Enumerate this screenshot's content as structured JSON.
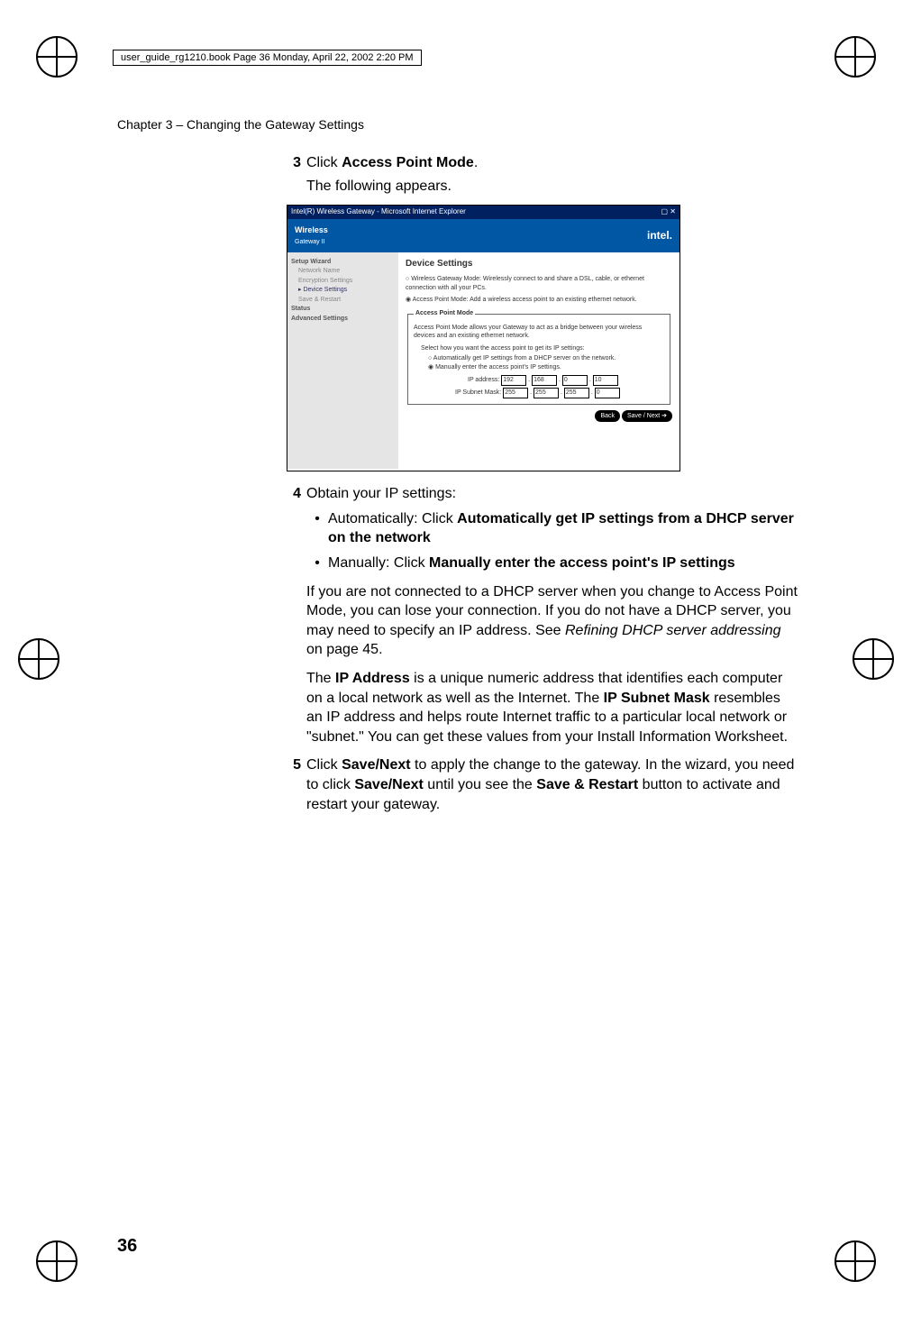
{
  "header": "user_guide_rg1210.book  Page 36  Monday, April 22, 2002  2:20 PM",
  "chapter": "Chapter 3  –  Changing the Gateway Settings",
  "page_number": "36",
  "steps": {
    "s3": {
      "num": "3",
      "click": "Click ",
      "bold1": "Access Point Mode",
      "period": ".",
      "sub": "The following appears."
    },
    "s4": {
      "num": "4",
      "text": "Obtain your IP settings:",
      "b1_pre": "Automatically: Click ",
      "b1_bold": "Automatically get IP settings from a DHCP server on the network",
      "b2_pre": "Manually: Click ",
      "b2_bold": "Manually enter the access point's IP settings"
    },
    "s5": {
      "num": "5",
      "pre": "Click ",
      "b1": "Save/Next",
      "mid1": " to apply the change to the gateway. In the wizard, you need to click ",
      "b2": "Save/Next",
      "mid2": " until you see the ",
      "b3": "Save & Restart",
      "end": " button to activate and restart your gateway."
    }
  },
  "para1": {
    "t1": "If you are not connected to a DHCP server when you change to Access Point Mode, you can lose your connection. If you do not have a DHCP server, you may need to specify an IP address. See ",
    "ital": "Refining DHCP server addressing",
    "t2": " on page 45."
  },
  "para2": {
    "t1": "The ",
    "b1": "IP Address",
    "t2": " is a unique numeric address that identifies each computer on a local network as well as the Internet. The ",
    "b2": "IP Subnet Mask",
    "t3": " resembles an IP address and helps route Internet traffic to a particular local network or \"subnet.\" You can get these values from your Install Information Worksheet."
  },
  "screenshot": {
    "titlebar": "Intel(R) Wireless Gateway - Microsoft Internet Explorer",
    "brand_left": "Wireless",
    "brand_left2": "Gateway II",
    "brand_right": "intel.",
    "side": {
      "setup": "Setup Wizard",
      "nn": "Network Name",
      "es": "Encryption Settings",
      "ds": "Device Settings",
      "sr": "Save & Restart",
      "status": "Status",
      "adv": "Advanced Settings"
    },
    "main": {
      "heading": "Device Settings",
      "opt1": "Wireless Gateway Mode: Wirelessly connect to and share a DSL, cable, or ethernet connection with all your PCs.",
      "opt2": "Access Point Mode: Add a wireless access point to an existing ethernet network.",
      "legend": "Access Point Mode",
      "desc": "Access Point Mode allows your Gateway to act as a bridge between your wireless devices and an existing ethernet network.",
      "select": "Select how you want the access point to get its IP settings:",
      "auto": "Automatically get IP settings from a DHCP server on the network.",
      "manual": "Manually enter the access point's IP settings.",
      "ip_label": "IP address:",
      "ip": [
        "192",
        "168",
        "0",
        "10"
      ],
      "mask_label": "IP Subnet Mask:",
      "mask": [
        "255",
        "255",
        "255",
        "0"
      ],
      "back": "Back",
      "next": "Save / Next  ➔"
    }
  }
}
